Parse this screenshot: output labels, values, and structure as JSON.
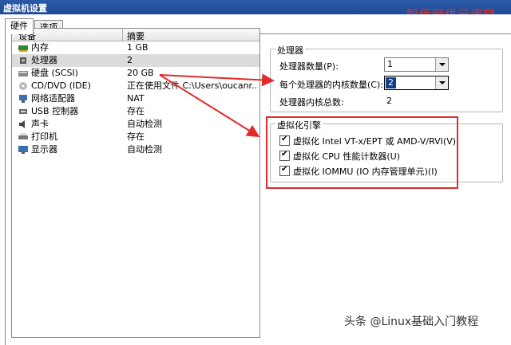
{
  "window": {
    "title": "虚拟机设置"
  },
  "watermark_top": "智传网优云课堂",
  "tabs": [
    {
      "label": "硬件"
    },
    {
      "label": "选项"
    }
  ],
  "list": {
    "col_device": "设备",
    "col_summary": "摘要",
    "rows": [
      {
        "name": "内存",
        "summary": "1 GB",
        "icon": "memory-icon"
      },
      {
        "name": "处理器",
        "summary": "2",
        "icon": "cpu-icon"
      },
      {
        "name": "硬盘 (SCSI)",
        "summary": "20 GB",
        "icon": "disk-icon"
      },
      {
        "name": "CD/DVD (IDE)",
        "summary": "正在使用文件 C:\\Users\\oucanr...",
        "icon": "cd-icon"
      },
      {
        "name": "网络适配器",
        "summary": "NAT",
        "icon": "network-icon"
      },
      {
        "name": "USB 控制器",
        "summary": "存在",
        "icon": "usb-icon"
      },
      {
        "name": "声卡",
        "summary": "自动检测",
        "icon": "sound-icon"
      },
      {
        "name": "打印机",
        "summary": "存在",
        "icon": "printer-icon"
      },
      {
        "name": "显示器",
        "summary": "自动检测",
        "icon": "display-icon"
      }
    ]
  },
  "processor": {
    "group_label": "处理器",
    "count_label": "处理器数量(P):",
    "count_value": "1",
    "cores_label": "每个处理器的内核数量(C):",
    "cores_value": "2",
    "total_label": "处理器内核总数:",
    "total_value": "2"
  },
  "virt": {
    "group_label": "虚拟化引擎",
    "options": [
      {
        "label": "虚拟化 Intel VT-x/EPT 或 AMD-V/RVI(V)",
        "checked": true
      },
      {
        "label": "虚拟化 CPU 性能计数器(U)",
        "checked": true
      },
      {
        "label": "虚拟化 IOMMU (IO 内存管理单元)(I)",
        "checked": true
      }
    ]
  },
  "footer_watermark": "头条 @Linux基础入门教程",
  "colors": {
    "title_bg": "#1f4a96",
    "annotation": "#e32a2a",
    "selection": "#123d8c"
  }
}
